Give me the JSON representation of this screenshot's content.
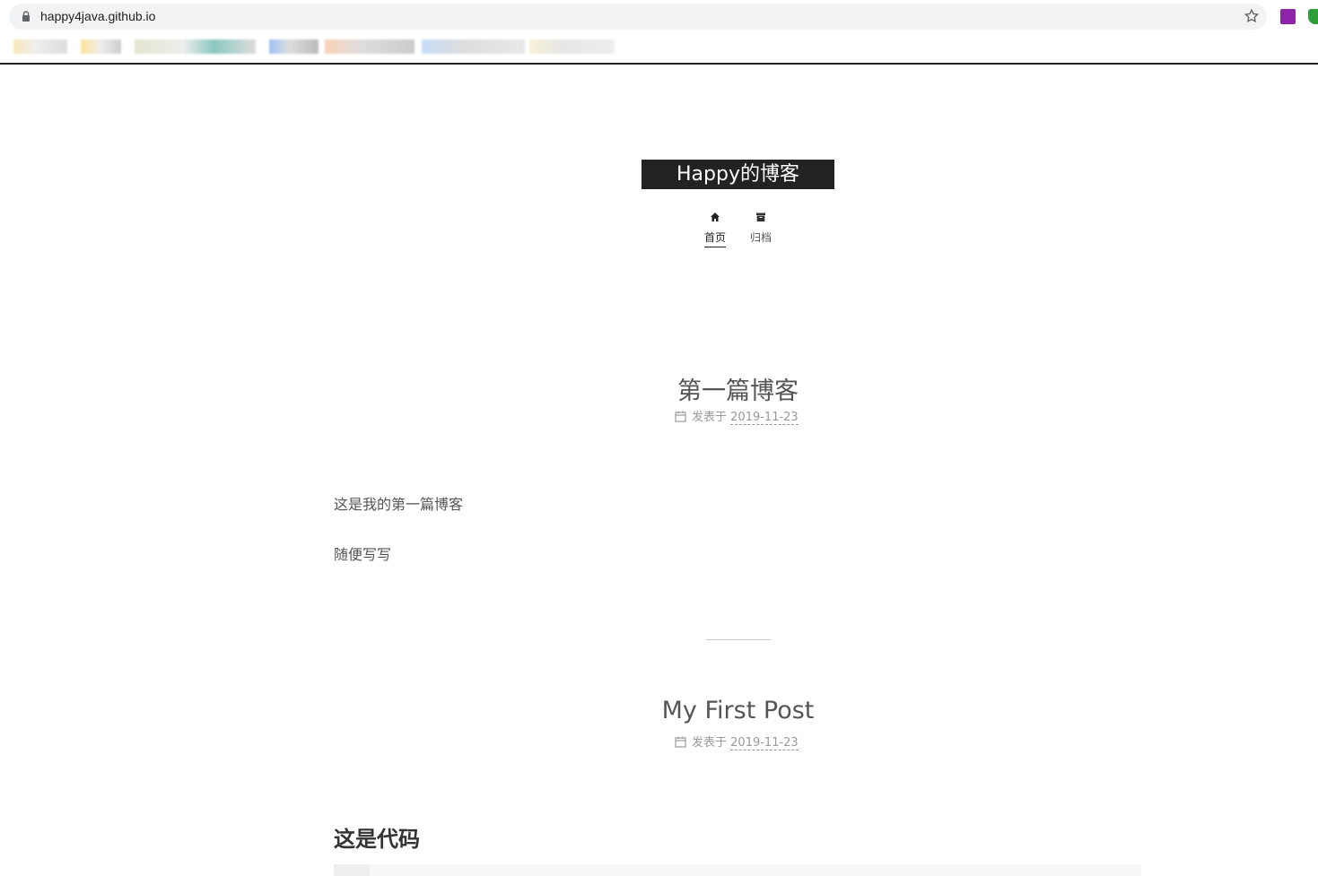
{
  "browser": {
    "url": "happy4java.github.io"
  },
  "site": {
    "brand": "Happy的博客",
    "nav": [
      {
        "label": "首页",
        "icon": "home-icon",
        "active": true
      },
      {
        "label": "归档",
        "icon": "archive-icon",
        "active": false
      }
    ]
  },
  "posts": [
    {
      "title": "第一篇博客",
      "meta_prefix": "发表于",
      "date": "2019-11-23",
      "paragraphs": [
        "这是我的第一篇博客",
        "随便写写"
      ]
    },
    {
      "title": "My First Post",
      "meta_prefix": "发表于",
      "date": "2019-11-23",
      "heading": "这是代码"
    }
  ],
  "colors": {
    "brand_bg": "#222222",
    "text": "#555555",
    "meta": "#999999"
  }
}
